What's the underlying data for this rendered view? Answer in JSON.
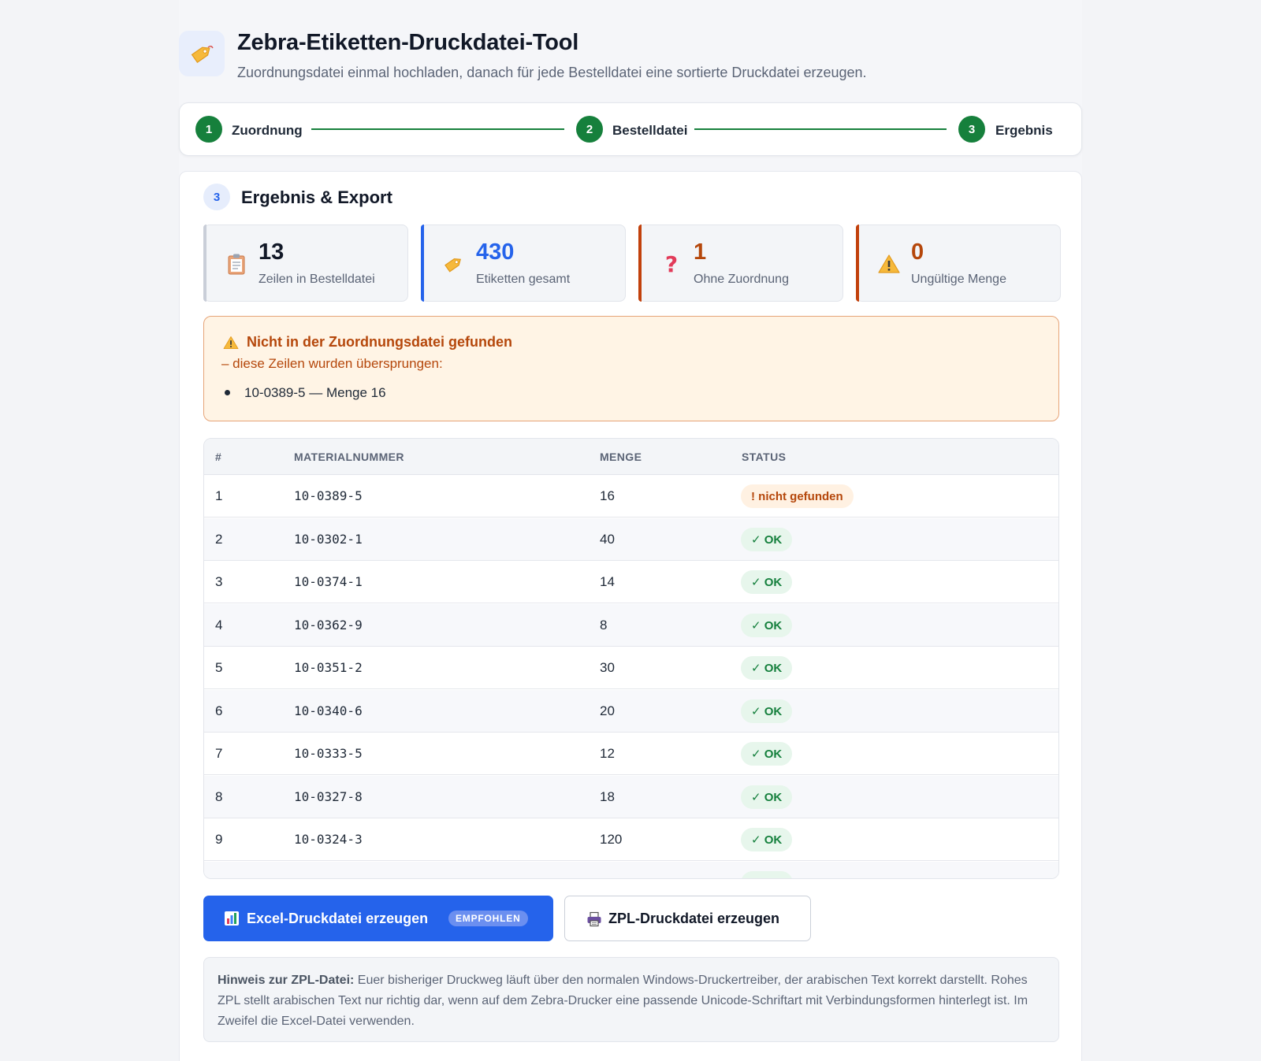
{
  "header": {
    "title": "Zebra-Etiketten-Druckdatei-Tool",
    "subtitle": "Zuordnungsdatei einmal hochladen, danach für jede Bestelldatei eine sortierte Druckdatei erzeugen."
  },
  "stepper": {
    "steps": [
      {
        "num": "1",
        "label": "Zuordnung"
      },
      {
        "num": "2",
        "label": "Bestelldatei"
      },
      {
        "num": "3",
        "label": "Ergebnis"
      }
    ]
  },
  "section": {
    "num": "3",
    "title": "Ergebnis & Export"
  },
  "stats": [
    {
      "value": "13",
      "label": "Zeilen in Bestelldatei",
      "icon": "clipboard-icon",
      "color": "#111827",
      "bar": "#c9ced8"
    },
    {
      "value": "430",
      "label": "Etiketten gesamt",
      "icon": "tag-icon",
      "color": "#2563eb",
      "bar": "#2563eb"
    },
    {
      "value": "1",
      "label": "Ohne Zuordnung",
      "icon": "question-icon",
      "color": "#b5470b",
      "bar": "#c2410c"
    },
    {
      "value": "0",
      "label": "Ungültige Menge",
      "icon": "warning-icon",
      "color": "#b5470b",
      "bar": "#c2410c"
    }
  ],
  "warning": {
    "title": "Nicht in der Zuordnungsdatei gefunden",
    "subtitle": "– diese Zeilen wurden übersprungen:",
    "items": [
      "10-0389-5 — Menge 16"
    ]
  },
  "table": {
    "headers": [
      "#",
      "MATERIALNUMMER",
      "MENGE",
      "STATUS"
    ],
    "rows": [
      {
        "n": "1",
        "material": "10-0389-5",
        "qty": "16",
        "status": "! nicht gefunden",
        "ok": false
      },
      {
        "n": "2",
        "material": "10-0302-1",
        "qty": "40",
        "status": "✓ OK",
        "ok": true
      },
      {
        "n": "3",
        "material": "10-0374-1",
        "qty": "14",
        "status": "✓ OK",
        "ok": true
      },
      {
        "n": "4",
        "material": "10-0362-9",
        "qty": "8",
        "status": "✓ OK",
        "ok": true
      },
      {
        "n": "5",
        "material": "10-0351-2",
        "qty": "30",
        "status": "✓ OK",
        "ok": true
      },
      {
        "n": "6",
        "material": "10-0340-6",
        "qty": "20",
        "status": "✓ OK",
        "ok": true
      },
      {
        "n": "7",
        "material": "10-0333-5",
        "qty": "12",
        "status": "✓ OK",
        "ok": true
      },
      {
        "n": "8",
        "material": "10-0327-8",
        "qty": "18",
        "status": "✓ OK",
        "ok": true
      },
      {
        "n": "9",
        "material": "10-0324-3",
        "qty": "120",
        "status": "✓ OK",
        "ok": true
      }
    ]
  },
  "buttons": {
    "excel_label": "Excel-Druckdatei erzeugen",
    "excel_chip": "EMPFOHLEN",
    "zpl_label": "ZPL-Druckdatei erzeugen"
  },
  "note": {
    "label": "Hinweis zur ZPL-Datei:",
    "text": " Euer bisheriger Druckweg läuft über den normalen Windows-Druckertreiber, der arabischen Text korrekt darstellt. Rohes ZPL stellt arabischen Text nur richtig dar, wenn auf dem Zebra-Drucker eine passende Unicode-Schriftart mit Verbindungsformen hinterlegt ist. Im Zweifel die Excel-Datei verwenden."
  }
}
